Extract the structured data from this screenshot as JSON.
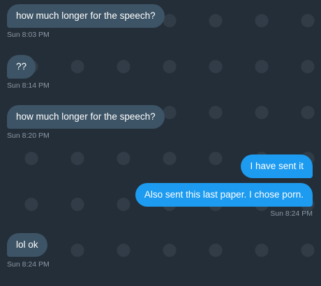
{
  "conversation": {
    "messages": [
      {
        "direction": "in",
        "text": "how much longer for the speech?",
        "timestamp": "Sun 8:03 PM"
      },
      {
        "direction": "in",
        "text": "??",
        "timestamp": "Sun 8:14 PM"
      },
      {
        "direction": "in",
        "text": "how much longer for the speech?",
        "timestamp": "Sun 8:20 PM"
      },
      {
        "direction": "out",
        "text": "I have sent it",
        "timestamp": ""
      },
      {
        "direction": "out",
        "text": "Also sent this last paper. I chose porn.",
        "timestamp": "Sun 8:24 PM"
      },
      {
        "direction": "in",
        "text": "lol ok",
        "timestamp": "Sun 8:24 PM"
      }
    ]
  },
  "colors": {
    "background": "#15202b",
    "incoming_bubble": "#3d5466",
    "outgoing_bubble": "#1d9bf0",
    "timestamp_text": "#8b98a5"
  },
  "icons": {
    "background_pattern": "wallpaper-pattern-icon"
  }
}
